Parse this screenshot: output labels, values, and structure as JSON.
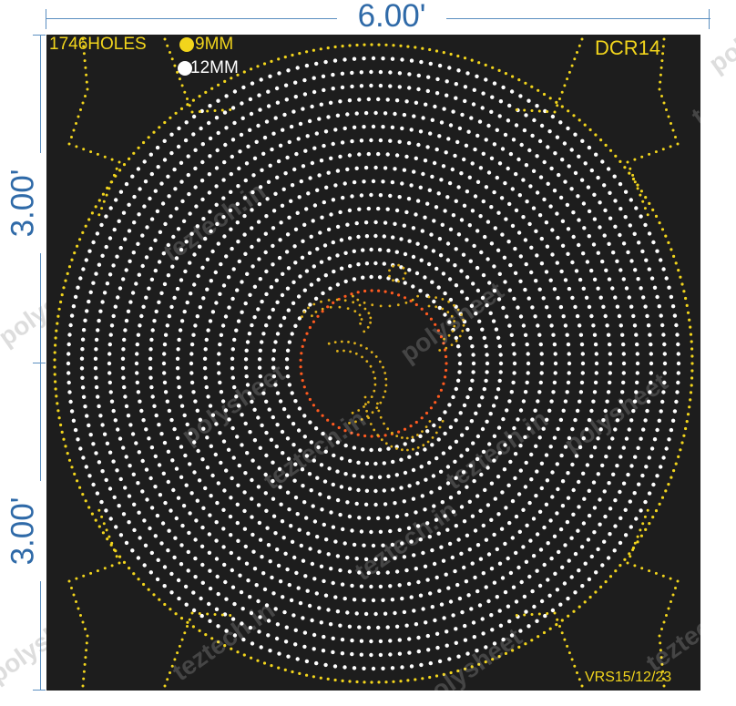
{
  "dimensions": {
    "width_label": "6.00'",
    "upper_height_label": "3.00'",
    "lower_height_label": "3.00'"
  },
  "panel": {
    "hole_count": "1746HOLES",
    "legend": [
      {
        "label": "9MM",
        "color": "#f2d51c"
      },
      {
        "label": "12MM",
        "color": "#ffffff"
      }
    ],
    "design_code": "DCR14",
    "version": "VRS15/12/23"
  },
  "watermarks": [
    "polysheet",
    "teztech.in"
  ],
  "colors": {
    "background": "#1d1d1d",
    "hole_white": "#ffffff",
    "hole_yellow": "#f2d51c",
    "hole_orange": "#ff5a1f",
    "hole_gold": "#e0b21a",
    "dimension": "#2f6aa8"
  }
}
